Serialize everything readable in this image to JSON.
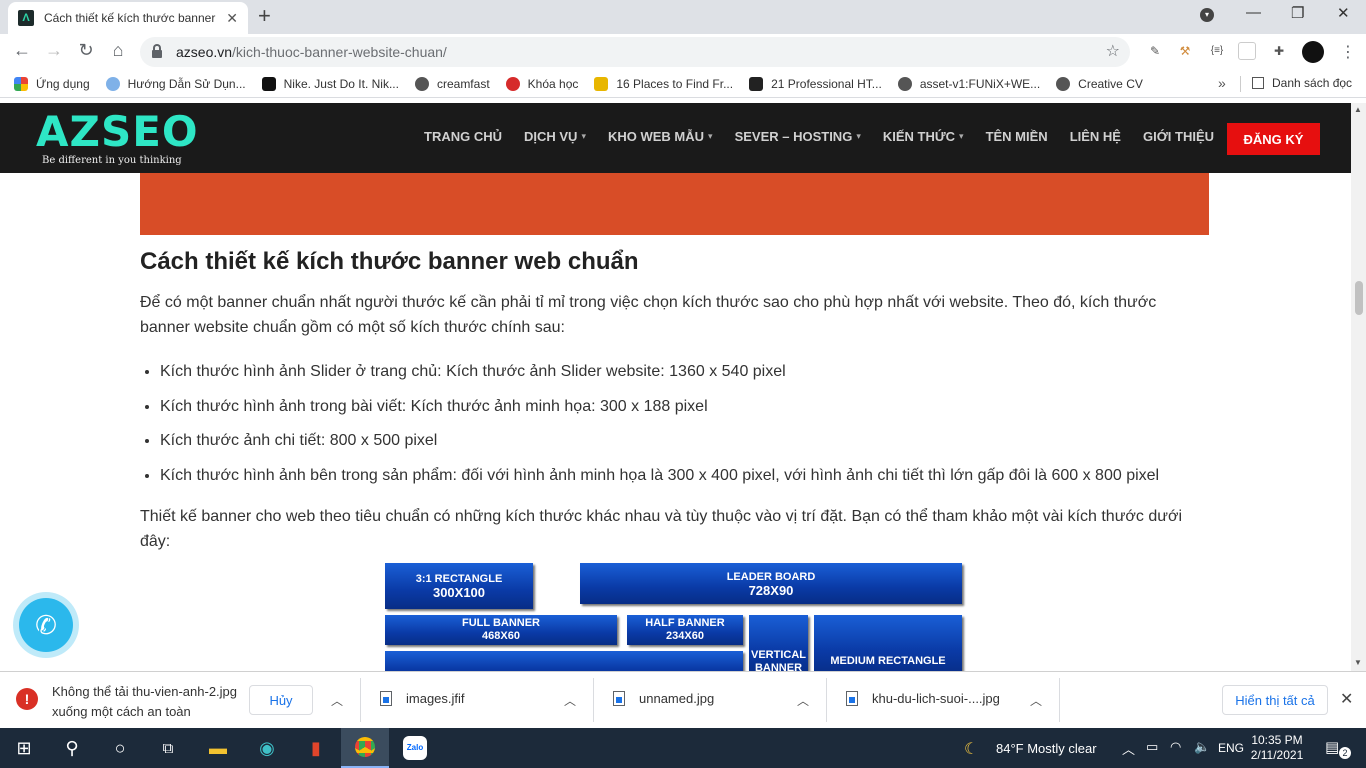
{
  "browser": {
    "tab_title": "Cách thiết kế kích thước banner website chuẩn",
    "new_tab": "+",
    "url_host": "azseo.vn",
    "url_path": "/kich-thuoc-banner-website-chuan/",
    "bookmarks": [
      {
        "label": "Ứng dụng",
        "color": "#ea4335"
      },
      {
        "label": "Hướng Dẫn Sử Dụn...",
        "color": "#7fb1e8"
      },
      {
        "label": "Nike. Just Do It. Nik...",
        "color": "#111111"
      },
      {
        "label": "creamfast",
        "color": "#555555"
      },
      {
        "label": "Khóa học",
        "color": "#d62b2b"
      },
      {
        "label": "16 Places to Find Fr...",
        "color": "#e8b600"
      },
      {
        "label": "21 Professional HT...",
        "color": "#222222"
      },
      {
        "label": "asset-v1:FUNiX+WE...",
        "color": "#555555"
      },
      {
        "label": "Creative CV",
        "color": "#555555"
      }
    ],
    "more_bookmarks": "»",
    "reading_list": "Danh sách đọc"
  },
  "site": {
    "logo": "AZSEO",
    "tagline": "Be different in you thinking",
    "menu": [
      {
        "label": "TRANG CHỦ",
        "dropdown": ""
      },
      {
        "label": "DỊCH VỤ",
        "dropdown": "▾"
      },
      {
        "label": "KHO WEB MẪU",
        "dropdown": "▾"
      },
      {
        "label": "SEVER – HOSTING",
        "dropdown": "▾"
      },
      {
        "label": "KIẾN THỨC",
        "dropdown": "▾"
      },
      {
        "label": "TÊN MIỀN",
        "dropdown": ""
      },
      {
        "label": "LIÊN HỆ",
        "dropdown": ""
      },
      {
        "label": "GIỚI THIỆU",
        "dropdown": ""
      }
    ],
    "signup": "ĐĂNG KÝ",
    "accent_color": "#2ee6c5"
  },
  "article": {
    "heading": "Cách thiết kế kích thước banner web chuẩn",
    "intro": "Để có một banner chuẩn nhất người thước kế cần phải tỉ mỉ trong việc chọn kích thước sao cho phù hợp nhất với website. Theo đó, kích thước banner website chuẩn gồm có một số kích thước chính sau:",
    "bullets": [
      "Kích thước hình ảnh Slider ở trang chủ: Kích thước ảnh Slider website: 1360 x 540 pixel",
      "Kích thước hình ảnh trong bài viết: Kích thước ảnh minh họa: 300 x 188 pixel",
      "Kích thước ảnh chi tiết: 800 x 500 pixel",
      "Kích thước hình ảnh bên trong sản phẩm: đối với hình ảnh minh họa là 300 x 400 pixel, với hình ảnh chi tiết thì lớn gấp đôi là 600 x 800 pixel"
    ],
    "outro": "Thiết kế banner cho web theo tiêu chuẩn có những kích thước khác nhau và tùy thuộc vào vị trí đặt. Bạn có thể tham khảo một vài kích thước dưới đây:"
  },
  "diagram": {
    "rect_3_1": {
      "name": "3:1 RECTANGLE",
      "size": "300X100"
    },
    "leader": {
      "name": "LEADER BOARD",
      "size": "728X90"
    },
    "full": {
      "name": "FULL BANNER",
      "size": "468X60"
    },
    "half": {
      "name": "HALF BANNER",
      "size": "234X60"
    },
    "vertical": {
      "name": "VERTICAL",
      "size": "BANNER"
    },
    "medium": {
      "name": "MEDIUM RECTANGLE"
    }
  },
  "downloads": {
    "error_text_1": "Không thể tải thu-vien-anh-2.jpg",
    "error_text_2": "xuống một cách an toàn",
    "cancel": "Hủy",
    "files": [
      "images.jfif",
      "unnamed.jpg",
      "khu-du-lich-suoi-....jpg"
    ],
    "show_all": "Hiển thị tất cả"
  },
  "taskbar": {
    "weather": "84°F  Mostly clear",
    "language": "ENG",
    "time": "10:35 PM",
    "date": "2/11/2021",
    "notifications": "2"
  }
}
